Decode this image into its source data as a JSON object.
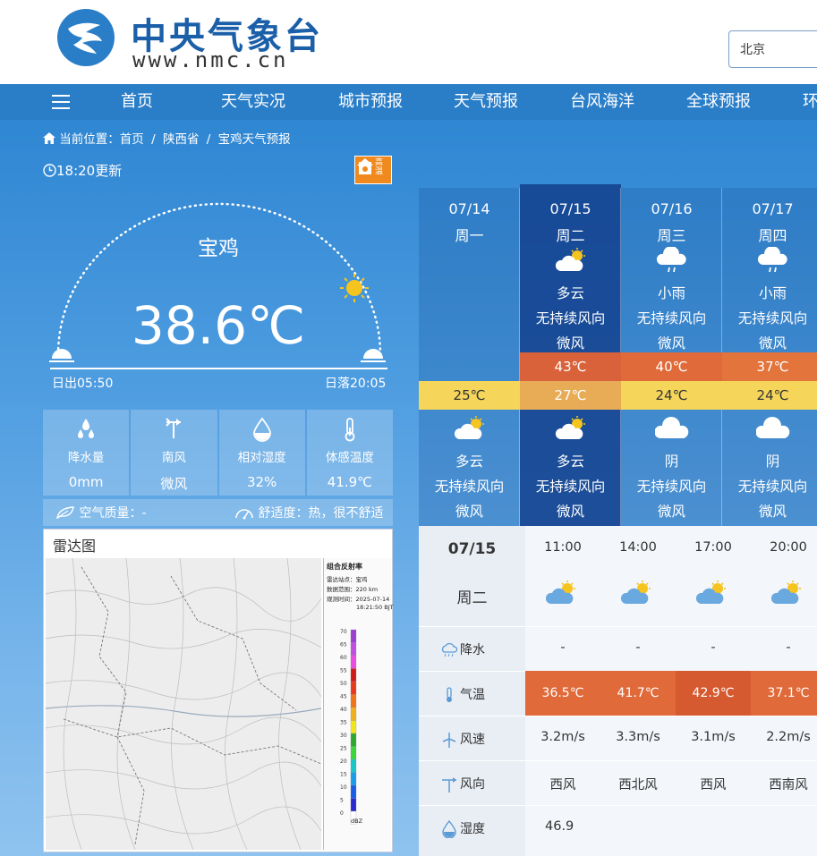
{
  "header": {
    "logo_cn": "中央气象台",
    "logo_en": "www.nmc.cn",
    "search_value": "北京"
  },
  "nav": {
    "items": [
      "首页",
      "天气实况",
      "城市预报",
      "天气预报",
      "台风海洋",
      "全球预报",
      "环"
    ]
  },
  "breadcrumb": {
    "prefix": "当前位置：",
    "items": [
      "首页",
      "陕西省",
      "宝鸡天气预报"
    ],
    "sep": "/"
  },
  "current": {
    "updated": "18:20更新",
    "city": "宝鸡",
    "temperature": "38.6℃",
    "sunrise": "日出05:50",
    "sunset": "日落20:05",
    "warning_text": "高温"
  },
  "stats": [
    {
      "icon": "raindrops-icon",
      "label": "降水量",
      "value": "0mm"
    },
    {
      "icon": "wind-vane-icon",
      "label": "南风",
      "value": "微风"
    },
    {
      "icon": "humidity-drop-icon",
      "label": "相对湿度",
      "value": "32%"
    },
    {
      "icon": "thermometer-icon",
      "label": "体感温度",
      "value": "41.9℃"
    }
  ],
  "air": {
    "quality": "空气质量：-",
    "comfort": "舒适度：热，很不舒适"
  },
  "radar": {
    "title": "雷达图",
    "legend_title": "组合反射率",
    "station": "雷达站点：宝鸡",
    "range": "数据范围：220 km",
    "time_label": "观测时间：2025-07-14",
    "time_value": "18:21:50 BJT",
    "unit": "dBZ",
    "scale": [
      "70",
      "65",
      "60",
      "55",
      "50",
      "45",
      "40",
      "35",
      "30",
      "25",
      "20",
      "15",
      "10",
      "5",
      "0"
    ],
    "colors": [
      "#9a3fd0",
      "#c04fe0",
      "#e84ce0",
      "#d01a1a",
      "#e83a1a",
      "#f0741a",
      "#f0b21a",
      "#f0e61a",
      "#2fa82f",
      "#3bd63b",
      "#18c8c8",
      "#1a9ce8",
      "#1a5ce8",
      "#2a2ad0",
      "#ffffff"
    ]
  },
  "daily": [
    {
      "date": "07/14",
      "week": "周一",
      "day_weather": "",
      "day_wind_dir": "",
      "day_wind_force": "",
      "high": "",
      "low": "25℃",
      "night_weather": "多云",
      "night_wind_dir": "无持续风向",
      "night_wind_force": "微风",
      "day_icon": "",
      "night_icon": "partly-cloudy-icon"
    },
    {
      "date": "07/15",
      "week": "周二",
      "day_weather": "多云",
      "day_wind_dir": "无持续风向",
      "day_wind_force": "微风",
      "high": "43℃",
      "low": "27℃",
      "night_weather": "多云",
      "night_wind_dir": "无持续风向",
      "night_wind_force": "微风",
      "day_icon": "partly-cloudy-icon",
      "night_icon": "partly-cloudy-icon"
    },
    {
      "date": "07/16",
      "week": "周三",
      "day_weather": "小雨",
      "day_wind_dir": "无持续风向",
      "day_wind_force": "微风",
      "high": "40℃",
      "low": "24℃",
      "night_weather": "阴",
      "night_wind_dir": "无持续风向",
      "night_wind_force": "微风",
      "day_icon": "light-rain-icon",
      "night_icon": "overcast-icon"
    },
    {
      "date": "07/17",
      "week": "周四",
      "day_weather": "小雨",
      "day_wind_dir": "无持续风向",
      "day_wind_force": "微风",
      "high": "37℃",
      "low": "24℃",
      "night_weather": "阴",
      "night_wind_dir": "无持续风向",
      "night_wind_force": "微风",
      "day_icon": "light-rain-icon",
      "night_icon": "overcast-icon"
    }
  ],
  "hourly": {
    "date": "07/15",
    "week": "周二",
    "row_labels": {
      "precip": "降水",
      "temp": "气温",
      "wind_speed": "风速",
      "wind_dir": "风向",
      "humidity": "湿度"
    },
    "hours": [
      {
        "time": "11:00",
        "precip": "-",
        "temp": "36.5℃",
        "wind_speed": "3.2m/s",
        "wind_dir": "西风",
        "humidity": "46.9"
      },
      {
        "time": "14:00",
        "precip": "-",
        "temp": "41.7℃",
        "wind_speed": "3.3m/s",
        "wind_dir": "西北风",
        "humidity": ""
      },
      {
        "time": "17:00",
        "precip": "-",
        "temp": "42.9℃",
        "wind_speed": "3.1m/s",
        "wind_dir": "西风",
        "humidity": ""
      },
      {
        "time": "20:00",
        "precip": "-",
        "temp": "37.1℃",
        "wind_speed": "2.2m/s",
        "wind_dir": "西南风",
        "humidity": ""
      }
    ]
  },
  "colors": {
    "brand_blue": "#1a5fa8",
    "nav_blue": "#2a7ec8",
    "high_temp": "#d9623a",
    "low_temp": "#f5d55a",
    "warning_orange": "#f08a1e"
  }
}
